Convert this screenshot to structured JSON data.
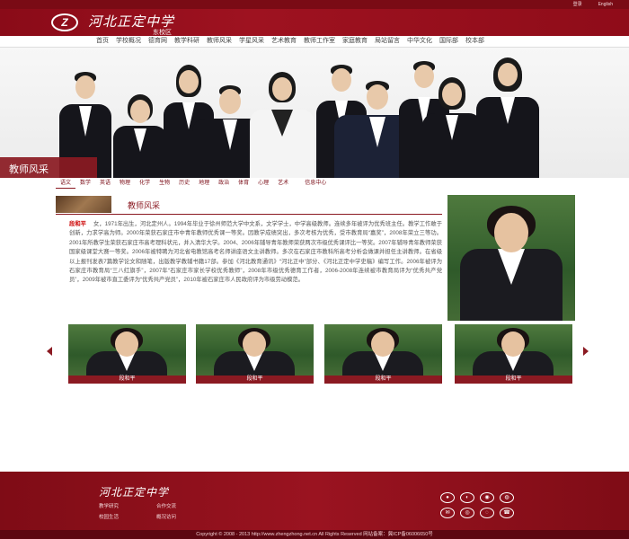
{
  "topbar": {
    "links": [
      "登录",
      "English"
    ]
  },
  "header": {
    "logo_mark": "Z",
    "school_name": "河北正定中学",
    "campus": "东校区"
  },
  "nav": {
    "items": [
      "首页",
      "学校概况",
      "德育网",
      "教学科研",
      "教师风采",
      "学星风采",
      "艺术教育",
      "教师工作室",
      "家庭教育",
      "局站留言",
      "中华文化",
      "国际部",
      "校本部"
    ]
  },
  "banner": {
    "label": "教师风采"
  },
  "subjects": {
    "items": [
      "语文",
      "数学",
      "英语",
      "物理",
      "化学",
      "生物",
      "历史",
      "地理",
      "政治",
      "体育",
      "心理",
      "艺术",
      "信息中心"
    ],
    "active": 0
  },
  "section": {
    "title": "教师风采",
    "teacher_name": "段和平",
    "bio": "女，1971年出生，河北定州人。1994年毕业于徐州师范大学中文系，文学学士，中学高级教师。连续多年被评为优秀班主任。教学工作敢于创新，力求学高为师。2000年荣获石家庄市中青年教师优秀课一等奖。因教学成绩突出，多次考核为优秀，受市教育局“嘉奖”，2008年荣立三等功。2001年所教学生荣获石家庄市高考理科状元，并入清华大学。2004、2006年辅导青年教师荣获两次市级优秀课评比一等奖。2007年辅导青年教师荣获国家级课堂大赛一等奖。2006年被特聘为河北省电教馆高考名师讲座语文主讲教师。多次在石家庄市教科所高考分析会做课并担任主讲教师。在省级以上报刊发表7篇教学论文和随笔，出版教学教辅书籍17部。参加《河北教育通讯》“河北正中”部分、《河北正定中学史稿》编写工作。2006年被评为石家庄市教育局“三八红旗手”，2007年“石家庄市家长学校优秀教师”，2008年市级优秀德育工作者，2006-2008年连续被市教育局评为“优秀共产党员”，2009年被市直工委评为“优秀共产党员”，2010年被石家庄市人民政府评为市级劳动模范。"
  },
  "gallery": {
    "captions": [
      "段和平",
      "段和平",
      "段和平",
      "段和平"
    ]
  },
  "footer": {
    "logo_text": "河北正定中学",
    "links": [
      "教学研究",
      "合作交流",
      "校园生活",
      "概况访问"
    ],
    "social_icons": [
      "weibo-icon",
      "wechat-icon",
      "qq-icon",
      "weibo-alt-icon",
      "mail-icon",
      "share-icon",
      "rss-icon",
      "phone-icon"
    ],
    "copyright": "Copyright © 2008 - 2013 http://www.zhengzhong.net.cn All Rights Reserved 网站备案：冀ICP备06006650号"
  },
  "colors": {
    "brand": "#8b1a22",
    "header": "#9e1220",
    "footer": "#7f0c16"
  }
}
